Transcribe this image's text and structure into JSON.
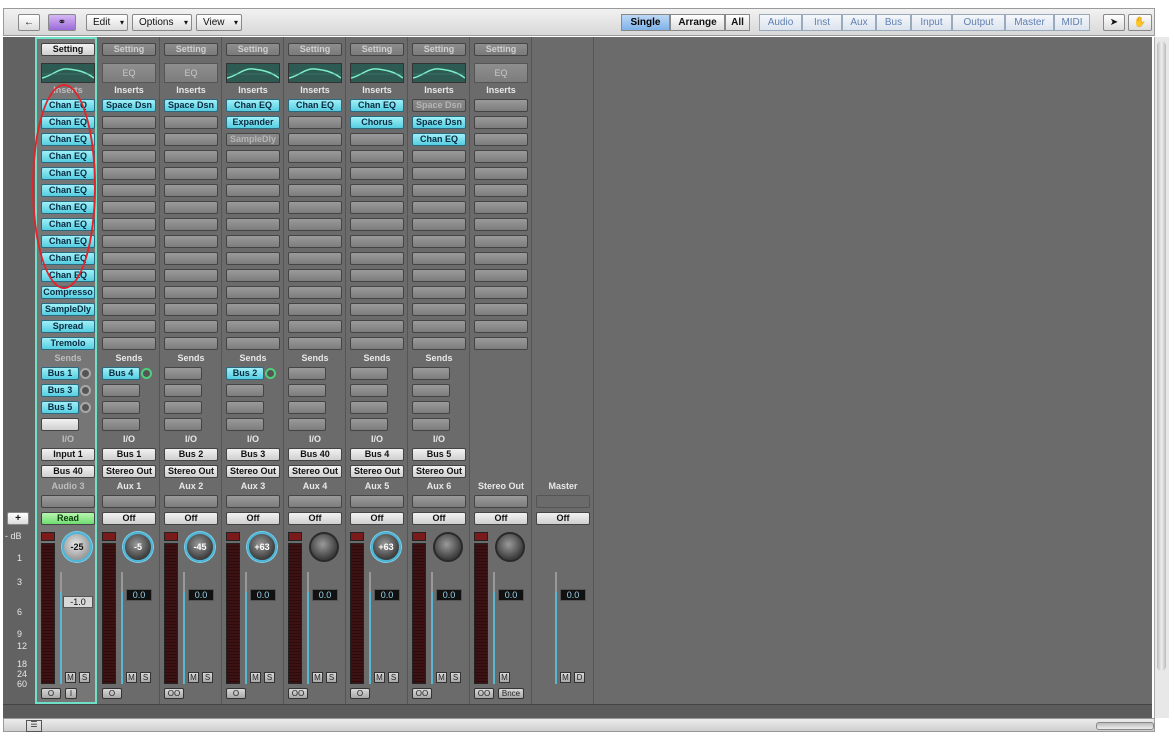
{
  "toolbar": {
    "back_icon": "back-arrow-icon",
    "link_icon": "link-icon",
    "menus": [
      "Edit",
      "Options",
      "View"
    ],
    "views": [
      "Single",
      "Arrange",
      "All"
    ],
    "active_view": "Single",
    "filters": [
      "Audio",
      "Inst",
      "Aux",
      "Bus",
      "Input",
      "Output",
      "Master",
      "MIDI"
    ],
    "pointer_tool_icon": "pointer-icon",
    "hand_tool_icon": "hand-icon"
  },
  "scale_labels": [
    "- dB",
    "1",
    "3",
    "6",
    "9",
    "12",
    "18",
    "24",
    "60"
  ],
  "add_label": "+",
  "strips": [
    {
      "setting": "Setting",
      "eq": "curve",
      "inserts_label": "Inserts",
      "inserts": [
        "Chan EQ",
        "Chan EQ",
        "Chan EQ",
        "Chan EQ",
        "Chan EQ",
        "Chan EQ",
        "Chan EQ",
        "Chan EQ",
        "Chan EQ",
        "Chan EQ",
        "Chan EQ",
        "Compresso",
        "SampleDly",
        "Spread",
        "Tremolo"
      ],
      "sends_label": "Sends",
      "sends": [
        "Bus 1",
        "Bus 3",
        "Bus 5"
      ],
      "io_label": "I/O",
      "input": "Input 1",
      "output": "Bus 40",
      "name": "Audio 3",
      "automation": "Read",
      "pan": "-25",
      "fader": "-1.0",
      "solo": "S",
      "mute": "M",
      "bottom": [
        "O",
        "I"
      ]
    },
    {
      "setting": "Setting",
      "eq": "EQ",
      "inserts_label": "Inserts",
      "inserts": [
        "Space Dsn"
      ],
      "sends_label": "Sends",
      "sends": [
        "Bus 4"
      ],
      "io_label": "I/O",
      "input": "Bus 1",
      "output": "Stereo Out",
      "name": "Aux 1",
      "automation": "Off",
      "pan": "-5",
      "fader": "0.0",
      "solo": "S",
      "mute": "M",
      "bottom": [
        "O"
      ]
    },
    {
      "setting": "Setting",
      "eq": "EQ",
      "inserts_label": "Inserts",
      "inserts": [
        "Space Dsn"
      ],
      "sends_label": "Sends",
      "sends": [],
      "io_label": "I/O",
      "input": "Bus 2",
      "output": "Stereo Out",
      "name": "Aux 2",
      "automation": "Off",
      "pan": "-45",
      "fader": "0.0",
      "solo": "S",
      "mute": "M",
      "bottom": [
        "OO"
      ]
    },
    {
      "setting": "Setting",
      "eq": "curve",
      "inserts_label": "Inserts",
      "inserts": [
        "Chan EQ",
        "Expander",
        "SampleDly"
      ],
      "sends_label": "Sends",
      "sends": [
        "Bus 2"
      ],
      "io_label": "I/O",
      "input": "Bus 3",
      "output": "Stereo Out",
      "name": "Aux 3",
      "automation": "Off",
      "pan": "+63",
      "fader": "0.0",
      "solo": "S",
      "mute": "M",
      "bottom": [
        "O"
      ]
    },
    {
      "setting": "Setting",
      "eq": "curve",
      "inserts_label": "Inserts",
      "inserts": [
        "Chan EQ"
      ],
      "sends_label": "Sends",
      "sends": [],
      "io_label": "I/O",
      "input": "Bus 40",
      "output": "Stereo Out",
      "name": "Aux 4",
      "automation": "Off",
      "pan": "",
      "fader": "0.0",
      "solo": "S",
      "mute": "M",
      "bottom": [
        "OO"
      ]
    },
    {
      "setting": "Setting",
      "eq": "curve",
      "inserts_label": "Inserts",
      "inserts": [
        "Chan EQ",
        "Chorus"
      ],
      "sends_label": "Sends",
      "sends": [],
      "io_label": "I/O",
      "input": "Bus 4",
      "output": "Stereo Out",
      "name": "Aux 5",
      "automation": "Off",
      "pan": "+63",
      "fader": "0.0",
      "solo": "S",
      "mute": "M",
      "bottom": [
        "O"
      ]
    },
    {
      "setting": "Setting",
      "eq": "curve",
      "inserts_label": "Inserts",
      "inserts": [
        "Space Dsn",
        "Space Dsn",
        "Chan EQ"
      ],
      "sends_label": "Sends",
      "sends": [],
      "io_label": "I/O",
      "input": "Bus 5",
      "output": "Stereo Out",
      "name": "Aux 6",
      "automation": "Off",
      "pan": "",
      "fader": "0.0",
      "solo": "S",
      "mute": "M",
      "bottom": [
        "OO"
      ]
    },
    {
      "setting": "Setting",
      "eq": "EQ",
      "inserts_label": "Inserts",
      "inserts": [],
      "sends_label": "",
      "sends": [],
      "io_label": "",
      "input": "",
      "output": "",
      "name": "Stereo Out",
      "automation": "Off",
      "pan": "",
      "fader": "0.0",
      "solo": "",
      "mute": "M",
      "bottom": [
        "OO",
        "Bnce"
      ]
    },
    {
      "setting": "",
      "eq": "",
      "inserts_label": "",
      "inserts": [],
      "sends_label": "",
      "sends": [],
      "io_label": "",
      "input": "",
      "output": "",
      "name": "Master",
      "automation": "Off",
      "pan": "",
      "fader": "0.0",
      "solo": "D",
      "mute": "M",
      "bottom": []
    }
  ]
}
